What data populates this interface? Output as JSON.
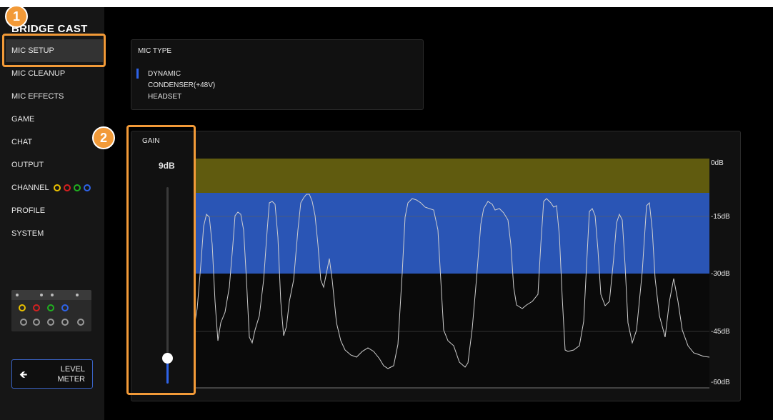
{
  "app": {
    "title": "BRIDGE CAST"
  },
  "sidebar": {
    "items": [
      {
        "label": "MIC SETUP",
        "active": true
      },
      {
        "label": "MIC CLEANUP"
      },
      {
        "label": "MIC EFFECTS"
      },
      {
        "label": "GAME"
      },
      {
        "label": "CHAT"
      },
      {
        "label": "OUTPUT"
      },
      {
        "label": "CHANNEL"
      },
      {
        "label": "PROFILE"
      },
      {
        "label": "SYSTEM"
      }
    ],
    "channel_colors": [
      "#e8c000",
      "#d42020",
      "#20b020",
      "#2e63e8"
    ],
    "level_meter_button": {
      "label_line1": "LEVEL",
      "label_line2": "METER",
      "icon": "arrow-left-icon"
    }
  },
  "mic_type": {
    "title": "MIC TYPE",
    "options": [
      "DYNAMIC",
      "CONDENSER(+48V)",
      "HEADSET"
    ],
    "selected": "DYNAMIC"
  },
  "gain": {
    "title": "GAIN",
    "value": "9dB",
    "level_fraction": 0.13
  },
  "meter": {
    "db_labels": [
      "0dB",
      "-15dB",
      "-30dB",
      "-45dB",
      "-60dB"
    ],
    "zone_colors": {
      "clip": "#605b0f",
      "target": "#2a55b5",
      "low": "#0a0a0a"
    }
  },
  "callouts": [
    "1",
    "2"
  ],
  "colors": {
    "accent": "#2e63e8",
    "callout": "#f29a38"
  }
}
